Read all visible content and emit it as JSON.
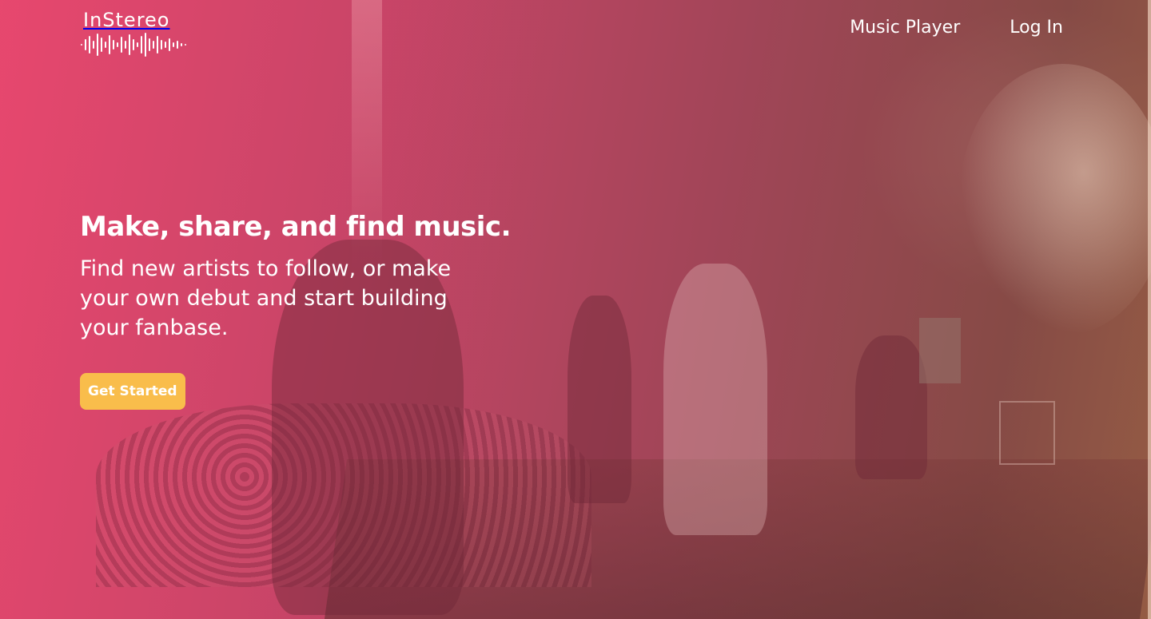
{
  "brand": {
    "name": "InStereo"
  },
  "nav": {
    "items": [
      {
        "label": "Music Player"
      },
      {
        "label": "Log In"
      }
    ]
  },
  "hero": {
    "headline": "Make, share, and find music.",
    "subheadline": "Find new artists to follow, or make your own debut and start building your fanbase.",
    "cta_label": "Get Started"
  },
  "colors": {
    "overlay_pink": "#e94870",
    "overlay_brown": "#8c4e48",
    "cta_yellow": "#f9bd4b",
    "text": "#ffffff"
  },
  "icons": {
    "logo_mark": "waveform-icon"
  }
}
